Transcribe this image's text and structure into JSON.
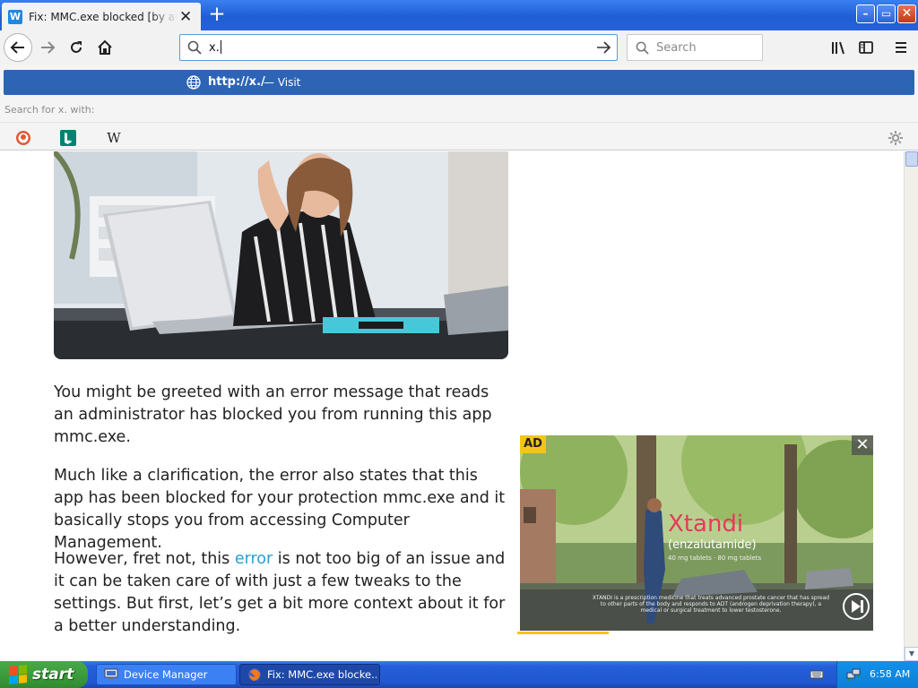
{
  "browser": {
    "tab": {
      "title": "Fix: MMC.exe blocked [by administrator]",
      "favicon_letter": "W",
      "close": "✕"
    },
    "new_tab": "+",
    "window_controls": {
      "minimize": "–",
      "maximize": "▭",
      "close": "✕"
    },
    "address_bar": {
      "value": "x."
    },
    "search_bar": {
      "placeholder": "Search"
    }
  },
  "url_dropdown": {
    "suggestion_url": "http://x./",
    "suggestion_action": "— Visit",
    "search_with_label": "Search for x. with:",
    "engines": [
      "duckduckgo-icon",
      "bing-icon",
      "wikipedia-icon"
    ],
    "wikipedia_glyph": "W"
  },
  "article": {
    "paragraph1": "You might be greeted with an error message that reads an administrator has blocked you from running this app mmc.exe.",
    "paragraph2": "Much like a clarification, the error also states that this app has been blocked for your protection mmc.exe and it basically stops you from accessing Computer Management.",
    "paragraph3_before": "However, fret not, this ",
    "paragraph3_link": "error",
    "paragraph3_after": " is not too big of an issue and it can be taken care of with just a few tweaks to the settings. But first, let’s get a bit more context about it for a better understanding."
  },
  "ad": {
    "badge": "AD",
    "close": "✕",
    "brand": "Xtandi",
    "generic": "(enzalutamide)",
    "dose": "40 mg tablets · 80 mg tablets",
    "fine_print": "XTANDI is a prescription medicine that treats advanced prostate cancer that has spread to other parts of the body and responds to ADT (androgen deprivation therapy), a medical or surgical treatment to lower testosterone.",
    "progress": 0.26
  },
  "taskbar": {
    "start_label": "start",
    "items": [
      {
        "label": "Device Manager"
      },
      {
        "label": "Fix: MMC.exe blocke..."
      }
    ],
    "clock": "6:58 AM"
  },
  "colors": {
    "accent_blue": "#2e64b5",
    "link": "#2a9fd0",
    "ad_yellow": "#f2c518"
  }
}
